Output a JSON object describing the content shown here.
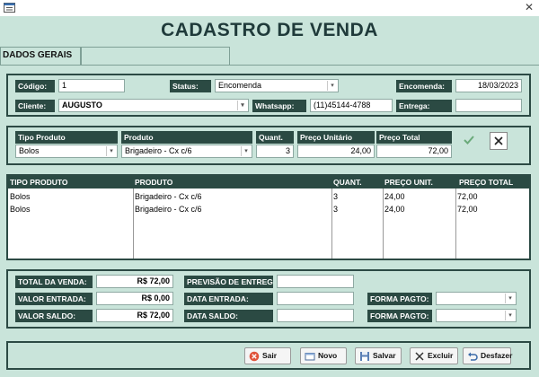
{
  "window": {
    "icon": "form-window-icon",
    "close_glyph": "✕"
  },
  "title": "CADASTRO DE VENDA",
  "tabs": [
    {
      "label": "DADOS GERAIS"
    }
  ],
  "header": {
    "codigo_label": "Código:",
    "codigo_value": "1",
    "status_label": "Status:",
    "status_value": "Encomenda",
    "encomenda_label": "Encomenda:",
    "encomenda_value": "18/03/2023",
    "cliente_label": "Cliente:",
    "cliente_value": "AUGUSTO",
    "whatsapp_label": "Whatsapp:",
    "whatsapp_value": "(11)45144-4788",
    "entrega_label": "Entrega:",
    "entrega_value": ""
  },
  "item_entry": {
    "tipo_label": "Tipo Produto",
    "tipo_value": "Bolos",
    "produto_label": "Produto",
    "produto_value": "Brigadeiro - Cx c/6",
    "quant_label": "Quant.",
    "quant_value": "3",
    "preco_unit_label": "Preço Unitário",
    "preco_unit_value": "24,00",
    "preco_total_label": "Preço Total",
    "preco_total_value": "72,00"
  },
  "grid": {
    "columns": [
      "TIPO PRODUTO",
      "PRODUTO",
      "QUANT.",
      "PREÇO UNIT.",
      "PREÇO TOTAL"
    ],
    "rows": [
      [
        "Bolos",
        "Brigadeiro - Cx c/6",
        "3",
        "24,00",
        "72,00"
      ],
      [
        "Bolos",
        "Brigadeiro - Cx c/6",
        "3",
        "24,00",
        "72,00"
      ]
    ]
  },
  "totals": {
    "total_venda_label": "TOTAL DA VENDA:",
    "total_venda_value": "R$ 72,00",
    "valor_entrada_label": "VALOR ENTRADA:",
    "valor_entrada_value": "R$ 0,00",
    "valor_saldo_label": "VALOR SALDO:",
    "valor_saldo_value": "R$ 72,00",
    "previsao_label": "PREVISÃO DE ENTREGA:",
    "previsao_value": "",
    "data_entrada_label": "DATA ENTRADA:",
    "data_entrada_value": "",
    "data_saldo_label": "DATA SALDO:",
    "data_saldo_value": "",
    "forma_pagto1_label": "FORMA PAGTO:",
    "forma_pagto1_value": "",
    "forma_pagto2_label": "FORMA PAGTO:",
    "forma_pagto2_value": ""
  },
  "buttons": {
    "sair": "Sair",
    "novo": "Novo",
    "salvar": "Salvar",
    "excluir": "Excluir",
    "desfazer": "Desfazer"
  },
  "colors": {
    "panel_bg": "#c9e4da",
    "label_bg": "#2b4a43",
    "title": "#1f3a3a"
  }
}
